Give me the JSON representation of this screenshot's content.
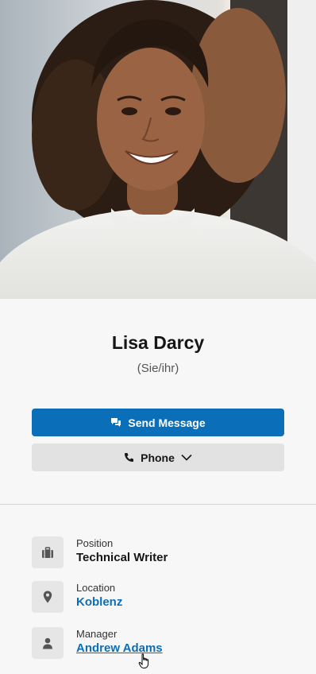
{
  "profile": {
    "name": "Lisa Darcy",
    "pronouns": "(Sie/ihr)"
  },
  "actions": {
    "send_message_label": "Send Message",
    "phone_label": "Phone"
  },
  "details": {
    "position": {
      "label": "Position",
      "value": "Technical Writer"
    },
    "location": {
      "label": "Location",
      "value": "Koblenz"
    },
    "manager": {
      "label": "Manager",
      "value": "Andrew Adams"
    }
  },
  "colors": {
    "accent": "#0a6fb8",
    "secondary_button": "#e2e2e2",
    "page_background": "#f7f7f7"
  },
  "icons": {
    "send_message": "chat-bubbles-icon",
    "phone": "phone-icon",
    "phone_menu": "chevron-down-icon",
    "position": "briefcase-icon",
    "location": "map-pin-icon",
    "manager": "person-icon"
  }
}
